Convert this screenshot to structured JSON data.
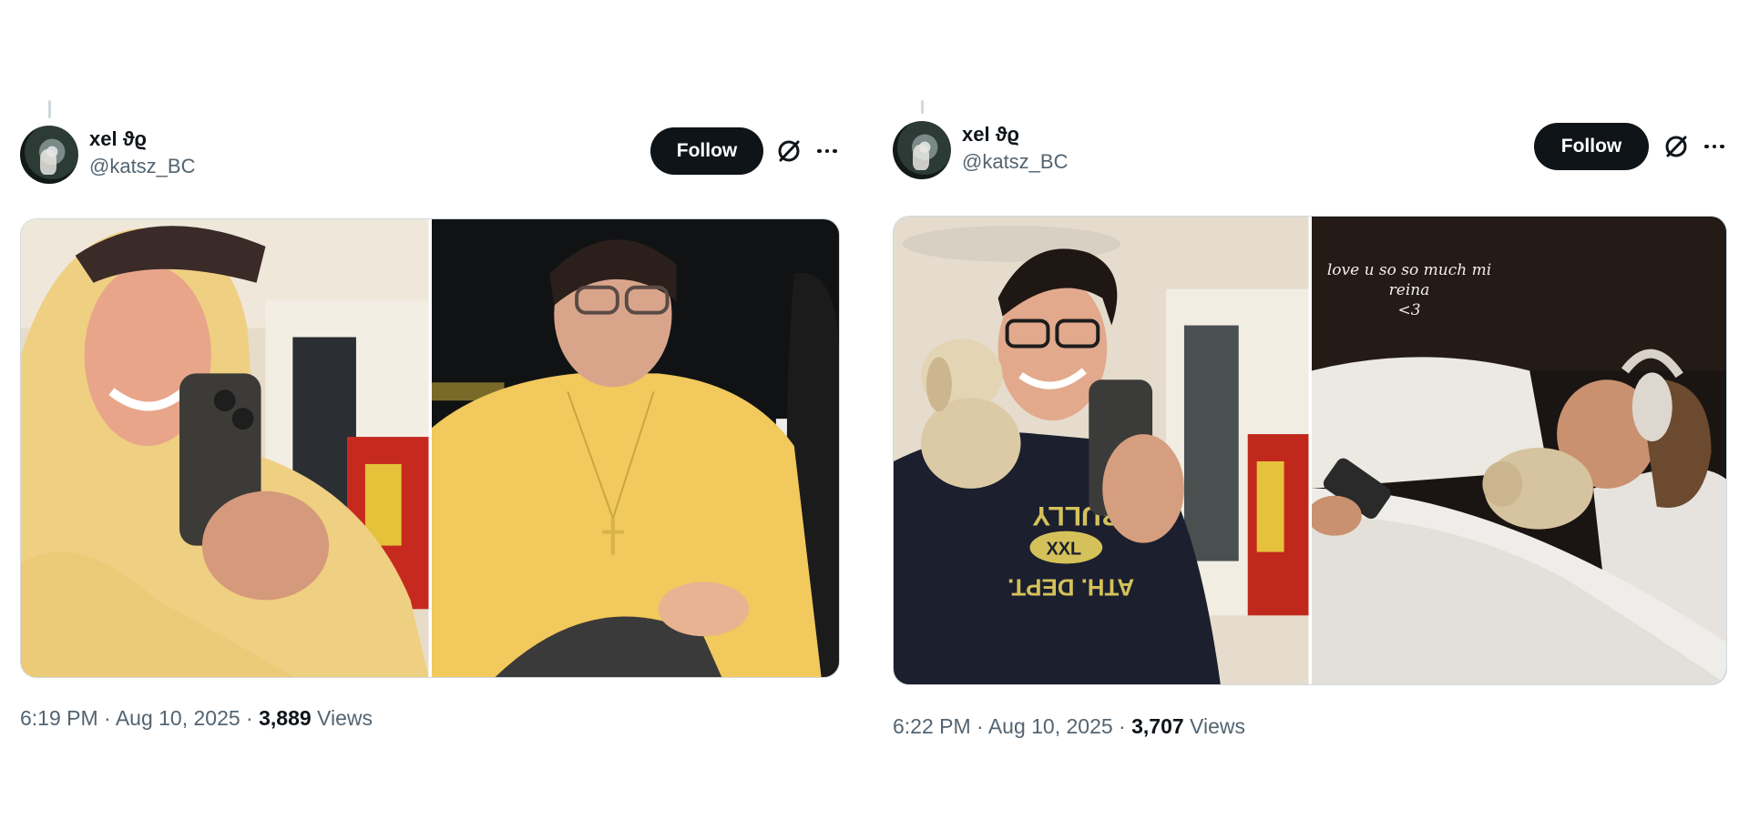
{
  "tweets": [
    {
      "user": {
        "display_name": "xel ϑϱ",
        "handle": "@katsz_BC"
      },
      "follow_label": "Follow",
      "time": "6:19 PM · Aug 10, 2025 · ",
      "views_count": "3,889",
      "views_label": " Views",
      "photos": [
        {
          "description": "smiling-person-yellow-hoodie-mirror-selfie"
        },
        {
          "description": "person-yellow-hoodie-glasses-cross-necklace"
        }
      ]
    },
    {
      "user": {
        "display_name": "xel ϑϱ",
        "handle": "@katsz_BC"
      },
      "follow_label": "Follow",
      "time": "6:22 PM · Aug 10, 2025 · ",
      "views_count": "3,707",
      "views_label": " Views",
      "photos": [
        {
          "description": "smiling-person-glasses-plush-dog-selfie",
          "shirt_text_1": "BULLY",
          "shirt_text_2": "XXL",
          "shirt_text_3": "ATH. DEPT."
        },
        {
          "description": "person-sleeping-headphones-plush",
          "overlay_line1": "love u so so much mi reina",
          "overlay_line2": "<3"
        }
      ]
    }
  ],
  "icons": {
    "grok": "grok-icon",
    "more": "more-icon"
  },
  "colors": {
    "follow_bg": "#0f1419",
    "secondary_text": "#536471",
    "border": "#cfd9de"
  }
}
